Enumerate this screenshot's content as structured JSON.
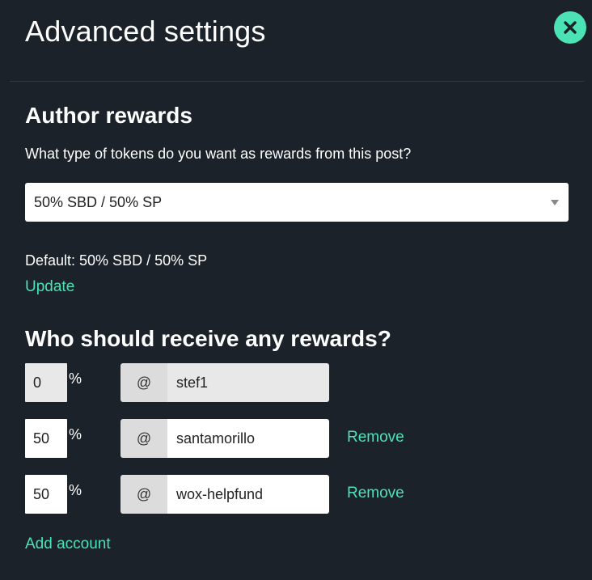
{
  "modal": {
    "title": "Advanced settings"
  },
  "author_rewards": {
    "heading": "Author rewards",
    "question": "What type of tokens do you want as rewards from this post?",
    "selected_option": "50% SBD / 50% SP",
    "default_text": "Default: 50% SBD / 50% SP",
    "update_label": "Update"
  },
  "beneficiaries": {
    "heading": "Who should receive any rewards?",
    "percent_sign": "%",
    "at_sign": "@",
    "remove_label": "Remove",
    "add_account_label": "Add account",
    "rows": [
      {
        "percent": "0",
        "account": "stef1",
        "editable": false
      },
      {
        "percent": "50",
        "account": "santamorillo",
        "editable": true
      },
      {
        "percent": "50",
        "account": "wox-helpfund",
        "editable": true
      }
    ]
  },
  "colors": {
    "background": "#1c222a",
    "accent": "#4be2b5",
    "text": "#ffffff"
  },
  "icons": {
    "close": "close-icon",
    "dropdown": "chevron-down-icon"
  }
}
